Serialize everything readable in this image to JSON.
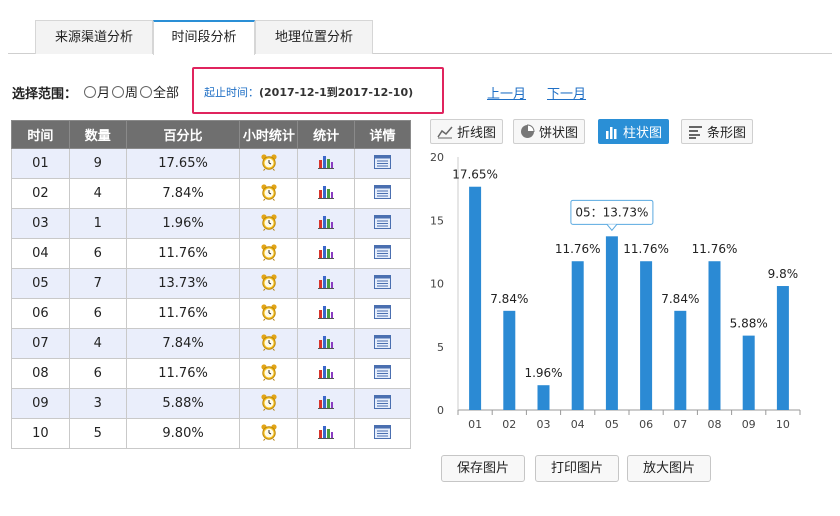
{
  "tabs": [
    {
      "label": "来源渠道分析"
    },
    {
      "label": "时间段分析"
    },
    {
      "label": "地理位置分析"
    }
  ],
  "filter": {
    "label": "选择范围：",
    "options": [
      "月",
      "周",
      "全部"
    ],
    "date_label": "起止时间：",
    "date_range": "(2017-12-1到2017-12-10)",
    "prev_label": "上一月",
    "next_label": "下一月"
  },
  "table": {
    "headers": [
      "时间",
      "数量",
      "百分比",
      "小时统计",
      "统计",
      "详情"
    ],
    "rows": [
      {
        "time": "01",
        "count": "9",
        "percent": "17.65%"
      },
      {
        "time": "02",
        "count": "4",
        "percent": "7.84%"
      },
      {
        "time": "03",
        "count": "1",
        "percent": "1.96%"
      },
      {
        "time": "04",
        "count": "6",
        "percent": "11.76%"
      },
      {
        "time": "05",
        "count": "7",
        "percent": "13.73%"
      },
      {
        "time": "06",
        "count": "6",
        "percent": "11.76%"
      },
      {
        "time": "07",
        "count": "4",
        "percent": "7.84%"
      },
      {
        "time": "08",
        "count": "6",
        "percent": "11.76%"
      },
      {
        "time": "09",
        "count": "3",
        "percent": "5.88%"
      },
      {
        "time": "10",
        "count": "5",
        "percent": "9.80%"
      }
    ],
    "icons": {
      "hour": "alarm-clock-icon",
      "stats": "bar-chart-icon",
      "detail": "list-detail-icon"
    }
  },
  "chart_types": [
    {
      "label": "折线图",
      "icon": "line-chart-icon"
    },
    {
      "label": "饼状图",
      "icon": "pie-chart-icon"
    },
    {
      "label": "柱状图",
      "icon": "column-chart-icon"
    },
    {
      "label": "条形图",
      "icon": "bar-list-icon"
    }
  ],
  "buttons": {
    "save": "保存图片",
    "print": "打印图片",
    "enlarge": "放大图片"
  },
  "colors": {
    "accent": "#2a8fd6",
    "bar": "#2b8ad4",
    "highlight_border": "#e0245e",
    "header_bg": "#6f6f6f",
    "row_alt": "#eaeefb"
  },
  "chart_data": {
    "type": "bar",
    "categories": [
      "01",
      "02",
      "03",
      "04",
      "05",
      "06",
      "07",
      "08",
      "09",
      "10"
    ],
    "values": [
      17.65,
      7.84,
      1.96,
      11.76,
      13.73,
      11.76,
      7.84,
      11.76,
      5.88,
      9.8
    ],
    "data_labels": [
      "17.65%",
      "7.84%",
      "1.96%",
      "11.76%",
      "",
      "11.76%",
      "7.84%",
      "11.76%",
      "5.88%",
      "9.8%"
    ],
    "ylim": [
      0,
      20
    ],
    "yticks": [
      "0",
      "5",
      "10",
      "15",
      "20"
    ],
    "tooltip": {
      "category": "05",
      "text": "05：13.73%"
    },
    "grid": false,
    "xlabel": "",
    "ylabel": ""
  }
}
